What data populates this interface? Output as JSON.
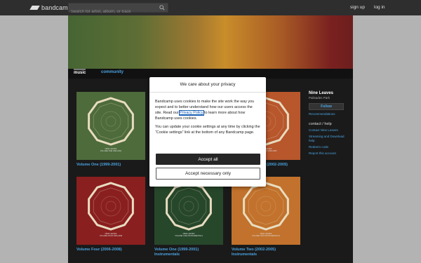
{
  "header": {
    "logo_text": "bandcamp",
    "search_placeholder": "Search for artist, album, or track",
    "signup_label": "sign up",
    "login_label": "log in"
  },
  "tabs": {
    "music": "music",
    "community": "community"
  },
  "albums": [
    {
      "title": "Volume One (1999-2001)",
      "cover_color": "#4e6b3b",
      "cover_text_1": "NINE LEAVES",
      "cover_text_2": "VOLUME ONE 1999-2001"
    },
    {
      "title": "",
      "cover_color": "",
      "cover_text_1": "",
      "cover_text_2": ""
    },
    {
      "title": "Volume Two (2002-2005)",
      "cover_color": "#b8562c",
      "cover_text_1": "NINE LEAVES",
      "cover_text_2": "VOLUME TWO 2002-2005"
    },
    {
      "title": "Volume Four (2006-2008)",
      "cover_color": "#8a1f1f",
      "cover_text_1": "NINE LEAVES",
      "cover_text_2": "VOLUME FOUR 2006-2008"
    },
    {
      "title": "Volume One (1999-2001) Instrumentals",
      "cover_color": "#27472b",
      "cover_text_1": "NINE LEAVES",
      "cover_text_2": "VOLUME ONE INSTRUMENTALS"
    },
    {
      "title": "Volume Two (2002-2005) Instrumentals",
      "cover_color": "#c2722c",
      "cover_text_1": "NINE LEAVES",
      "cover_text_2": "VOLUME TWO INSTRUMENTALS"
    }
  ],
  "album_3_title_visible": "(2002-2005)",
  "sidebar": {
    "artist": "Nine Leaves",
    "location": "Palisades Park",
    "follow_label": "Follow",
    "recommendations": "Recommendations",
    "contact_heading": "contact / help",
    "contact_link": "Contact Nine Leaves",
    "streaming_link": "Streaming and Download help",
    "redeem_link": "Redeem code",
    "report_link": "Report this account"
  },
  "dialog": {
    "title": "We care about your privacy",
    "para1_before": "Bandcamp uses cookies to make the site work the way you expect and to better understand how our users access the site. Read our ",
    "policy_link": "Privacy Policy",
    "para1_after": " to learn more about how Bandcamp uses cookies.",
    "para2": "You can update your cookie settings at any time by clicking the “Cookie settings” link at the bottom of any Bandcamp page.",
    "accept_all": "Accept all",
    "accept_necessary": "Accept necessary only"
  }
}
